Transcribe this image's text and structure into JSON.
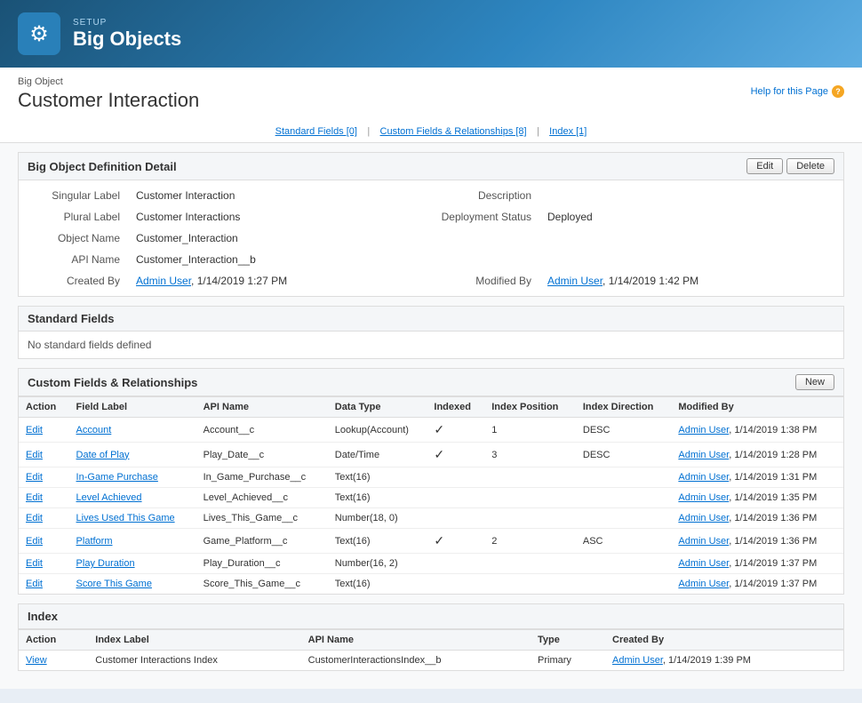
{
  "header": {
    "setup_label": "SETUP",
    "app_title": "Big Objects",
    "icon": "⚙"
  },
  "breadcrumb": {
    "parent": "Big Object",
    "title": "Customer Interaction",
    "help_link": "Help for this Page"
  },
  "nav_tabs": [
    {
      "label": "Standard Fields",
      "badge": "[0]"
    },
    {
      "label": "Custom Fields & Relationships",
      "badge": "[8]"
    },
    {
      "label": "Index",
      "badge": "[1]"
    }
  ],
  "definition_section": {
    "title": "Big Object Definition Detail",
    "edit_btn": "Edit",
    "delete_btn": "Delete",
    "fields": {
      "singular_label_key": "Singular Label",
      "singular_label_val": "Customer Interaction",
      "plural_label_key": "Plural Label",
      "plural_label_val": "Customer Interactions",
      "object_name_key": "Object Name",
      "object_name_val": "Customer_Interaction",
      "api_name_key": "API Name",
      "api_name_val": "Customer_Interaction__b",
      "created_by_key": "Created By",
      "created_by_val": "Admin User",
      "created_by_date": ", 1/14/2019 1:27 PM",
      "description_key": "Description",
      "description_val": "",
      "deployment_status_key": "Deployment Status",
      "deployment_status_val": "Deployed",
      "modified_by_key": "Modified By",
      "modified_by_val": "Admin User",
      "modified_by_date": ", 1/14/2019 1:42 PM"
    }
  },
  "standard_fields_section": {
    "title": "Standard Fields",
    "no_data": "No standard fields defined"
  },
  "custom_fields_section": {
    "title": "Custom Fields & Relationships",
    "new_btn": "New",
    "columns": [
      "Action",
      "Field Label",
      "API Name",
      "Data Type",
      "Indexed",
      "Index Position",
      "Index Direction",
      "Modified By"
    ],
    "rows": [
      {
        "action": "Edit",
        "field_label": "Account",
        "api_name": "Account__c",
        "data_type": "Lookup(Account)",
        "indexed": true,
        "index_position": "1",
        "index_direction": "DESC",
        "modified_by": "Admin User",
        "modified_date": ", 1/14/2019 1:38 PM"
      },
      {
        "action": "Edit",
        "field_label": "Date of Play",
        "api_name": "Play_Date__c",
        "data_type": "Date/Time",
        "indexed": true,
        "index_position": "3",
        "index_direction": "DESC",
        "modified_by": "Admin User",
        "modified_date": ", 1/14/2019 1:28 PM"
      },
      {
        "action": "Edit",
        "field_label": "In-Game Purchase",
        "api_name": "In_Game_Purchase__c",
        "data_type": "Text(16)",
        "indexed": false,
        "index_position": "",
        "index_direction": "",
        "modified_by": "Admin User",
        "modified_date": ", 1/14/2019 1:31 PM"
      },
      {
        "action": "Edit",
        "field_label": "Level Achieved",
        "api_name": "Level_Achieved__c",
        "data_type": "Text(16)",
        "indexed": false,
        "index_position": "",
        "index_direction": "",
        "modified_by": "Admin User",
        "modified_date": ", 1/14/2019 1:35 PM"
      },
      {
        "action": "Edit",
        "field_label": "Lives Used This Game",
        "api_name": "Lives_This_Game__c",
        "data_type": "Number(18, 0)",
        "indexed": false,
        "index_position": "",
        "index_direction": "",
        "modified_by": "Admin User",
        "modified_date": ", 1/14/2019 1:36 PM"
      },
      {
        "action": "Edit",
        "field_label": "Platform",
        "api_name": "Game_Platform__c",
        "data_type": "Text(16)",
        "indexed": true,
        "index_position": "2",
        "index_direction": "ASC",
        "modified_by": "Admin User",
        "modified_date": ", 1/14/2019 1:36 PM"
      },
      {
        "action": "Edit",
        "field_label": "Play Duration",
        "api_name": "Play_Duration__c",
        "data_type": "Number(16, 2)",
        "indexed": false,
        "index_position": "",
        "index_direction": "",
        "modified_by": "Admin User",
        "modified_date": ", 1/14/2019 1:37 PM"
      },
      {
        "action": "Edit",
        "field_label": "Score This Game",
        "api_name": "Score_This_Game__c",
        "data_type": "Text(16)",
        "indexed": false,
        "index_position": "",
        "index_direction": "",
        "modified_by": "Admin User",
        "modified_date": ", 1/14/2019 1:37 PM"
      }
    ]
  },
  "index_section": {
    "title": "Index",
    "columns": [
      "Action",
      "Index Label",
      "API Name",
      "Type",
      "Created By"
    ],
    "rows": [
      {
        "action": "View",
        "index_label": "Customer Interactions Index",
        "api_name": "CustomerInteractionsIndex__b",
        "type": "Primary",
        "created_by": "Admin User",
        "created_date": ", 1/14/2019 1:39 PM"
      }
    ]
  }
}
